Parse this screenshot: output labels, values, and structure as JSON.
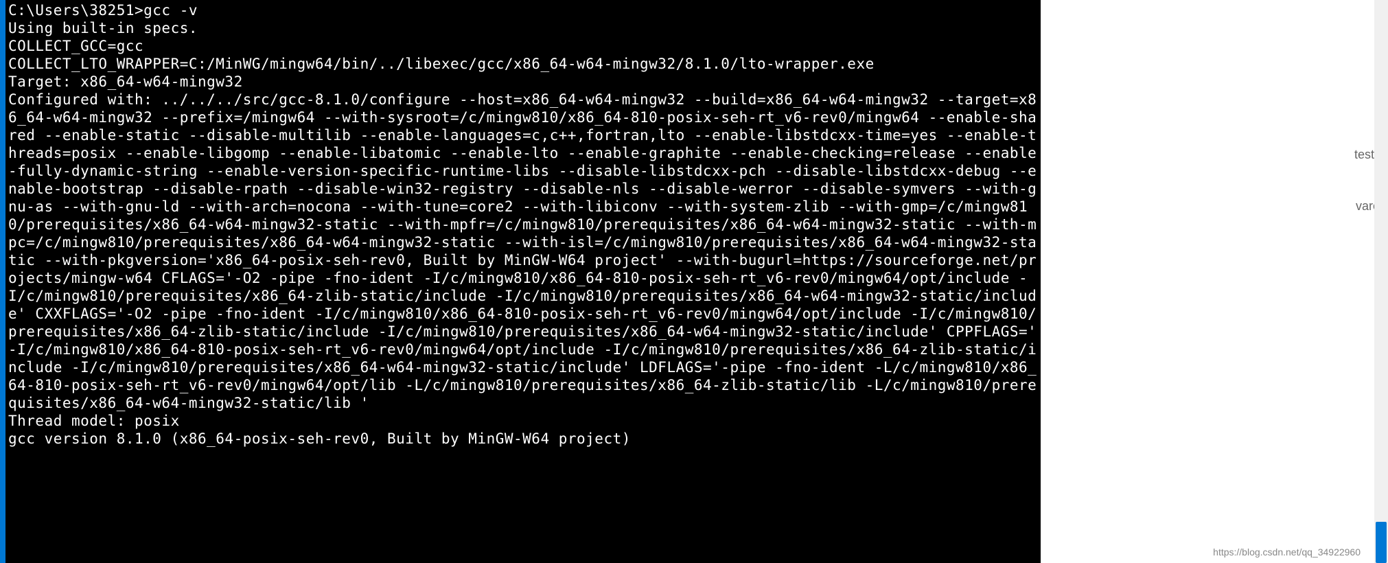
{
  "terminal": {
    "prompt": "C:\\Users\\38251>gcc -v",
    "lines": [
      "Using built-in specs.",
      "COLLECT_GCC=gcc",
      "COLLECT_LTO_WRAPPER=C:/MinWG/mingw64/bin/../libexec/gcc/x86_64-w64-mingw32/8.1.0/lto-wrapper.exe",
      "Target: x86_64-w64-mingw32",
      "Configured with: ../../../src/gcc-8.1.0/configure --host=x86_64-w64-mingw32 --build=x86_64-w64-mingw32 --target=x86_64-w64-mingw32 --prefix=/mingw64 --with-sysroot=/c/mingw810/x86_64-810-posix-seh-rt_v6-rev0/mingw64 --enable-shared --enable-static --disable-multilib --enable-languages=c,c++,fortran,lto --enable-libstdcxx-time=yes --enable-threads=posix --enable-libgomp --enable-libatomic --enable-lto --enable-graphite --enable-checking=release --enable-fully-dynamic-string --enable-version-specific-runtime-libs --disable-libstdcxx-pch --disable-libstdcxx-debug --enable-bootstrap --disable-rpath --disable-win32-registry --disable-nls --disable-werror --disable-symvers --with-gnu-as --with-gnu-ld --with-arch=nocona --with-tune=core2 --with-libiconv --with-system-zlib --with-gmp=/c/mingw810/prerequisites/x86_64-w64-mingw32-static --with-mpfr=/c/mingw810/prerequisites/x86_64-w64-mingw32-static --with-mpc=/c/mingw810/prerequisites/x86_64-w64-mingw32-static --with-isl=/c/mingw810/prerequisites/x86_64-w64-mingw32-static --with-pkgversion='x86_64-posix-seh-rev0, Built by MinGW-W64 project' --with-bugurl=https://sourceforge.net/projects/mingw-w64 CFLAGS='-O2 -pipe -fno-ident -I/c/mingw810/x86_64-810-posix-seh-rt_v6-rev0/mingw64/opt/include -I/c/mingw810/prerequisites/x86_64-zlib-static/include -I/c/mingw810/prerequisites/x86_64-w64-mingw32-static/include' CXXFLAGS='-O2 -pipe -fno-ident -I/c/mingw810/x86_64-810-posix-seh-rt_v6-rev0/mingw64/opt/include -I/c/mingw810/prerequisites/x86_64-zlib-static/include -I/c/mingw810/prerequisites/x86_64-w64-mingw32-static/include' CPPFLAGS=' -I/c/mingw810/x86_64-810-posix-seh-rt_v6-rev0/mingw64/opt/include -I/c/mingw810/prerequisites/x86_64-zlib-static/include -I/c/mingw810/prerequisites/x86_64-w64-mingw32-static/include' LDFLAGS='-pipe -fno-ident -L/c/mingw810/x86_64-810-posix-seh-rt_v6-rev0/mingw64/opt/lib -L/c/mingw810/prerequisites/x86_64-zlib-static/lib -L/c/mingw810/prerequisites/x86_64-w64-mingw32-static/lib '",
      "Thread model: posix",
      "gcc version 8.1.0 (x86_64-posix-seh-rev0, Built by MinGW-W64 project)"
    ]
  },
  "background": {
    "text1": "test",
    "text2": "vare"
  },
  "watermark": "https://blog.csdn.net/qq_34922960"
}
